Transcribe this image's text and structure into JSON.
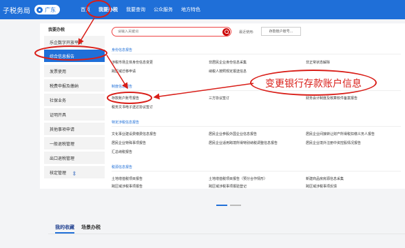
{
  "header": {
    "brand": "子税务局",
    "region": "广东",
    "nav": [
      "首页",
      "我要办税",
      "我要查询",
      "公众服务",
      "地方特色"
    ]
  },
  "leftmenu": {
    "title": "我要办税",
    "items": [
      "乐企数字开放平台",
      "综合信息报告",
      "发票使用",
      "税费申报及缴纳",
      "社保业务",
      "证明开具",
      "其他事项申请",
      "一般退税管理",
      "出口退税管理",
      "核定管理"
    ],
    "active_index": 1
  },
  "search": {
    "placeholder": "请输入关键词",
    "recent_label": "最近使用:",
    "recent_item": "存款账户账号..."
  },
  "sections": [
    {
      "title": "身份信息报告",
      "rows": [
        [
          "涉税市场主体身份信息变更",
          "非居民企业身份信息采集",
          "非正常状态解除"
        ],
        [
          "跨区域迁移申请",
          "纳税人按照规定报送信息",
          ""
        ]
      ]
    },
    {
      "title": "制度信息报告",
      "rows": [
        [
          "存款账户账号报告",
          "三方协议签订",
          "财务会计制度及核算软件备案报告"
        ],
        [
          "税务文书电子送达协议签订",
          "",
          ""
        ]
      ]
    },
    {
      "title": "特定涉税信息报告",
      "rows": [
        [
          "文化事业建设费缴费信息报告",
          "居民企业参股外国企业信息报告",
          "居民企业间接转让财产所得税扣缴义务人报告"
        ],
        [
          "居民企业特殊事项报告",
          "居民企业适用跨境所得特别纳税调整信息报告",
          "居民企业境外注册中资控股情况报告"
        ],
        [
          "汇总纳税报告",
          "",
          ""
        ]
      ]
    },
    {
      "title": "税源信息报告",
      "rows": [
        [
          "土地增值税项目报告",
          "土地增值税项目报告（预分合作情形）",
          "新建商品房房源信息采集"
        ],
        [
          "跨区域涉税事项报告",
          "跨区域涉税事项报验登记",
          "跨区域涉税事项反馈"
        ]
      ]
    }
  ],
  "annotation": {
    "text": "变更银行存款账户信息"
  },
  "bottom": {
    "tabs": [
      "我的收藏",
      "场景办税"
    ],
    "active_index": 0
  },
  "colors": {
    "brand_blue": "#1f6fd8",
    "annotation_red": "#d91e18"
  }
}
